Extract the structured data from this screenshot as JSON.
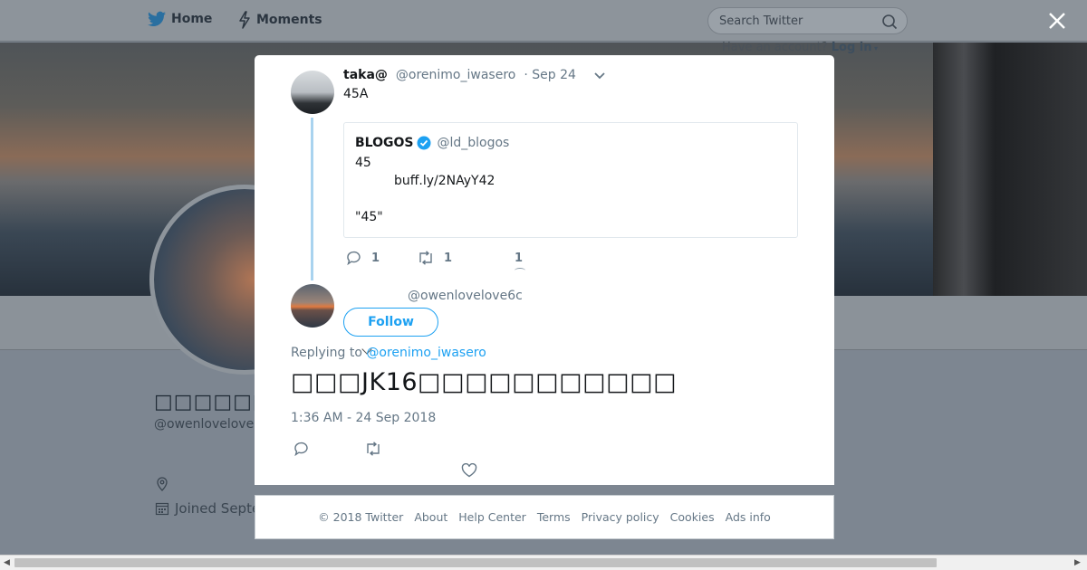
{
  "topbar": {
    "home_label": "Home",
    "moments_label": "Moments",
    "search_placeholder": "Search Twitter",
    "have_account": "Have an account?",
    "login_label": "Log in"
  },
  "profile": {
    "name": "□□□□□□□□□",
    "handle": "@owenlovelove",
    "joined": "Joined Septe"
  },
  "tweet": {
    "name": "taka@",
    "handle": "@orenimo_iwasero",
    "date": "· Sep 24",
    "text": "45A",
    "quote": {
      "name": "BLOGOS",
      "handle": "@ld_blogos",
      "line1": "45",
      "line2": "buff.ly/2NAyY42",
      "line3": "\"45\""
    },
    "reply_count": "1",
    "retweet_count": "1",
    "like_count": "1"
  },
  "reply": {
    "handle": "@owenlovelove6c",
    "follow_label": "Follow",
    "replying_to_label": "Replying to",
    "replying_to_handle": "@orenimo_iwasero",
    "text": "□□□JK16□□□□□□□□□□□",
    "timestamp": "1:36 AM - 24 Sep 2018"
  },
  "footer": {
    "links": [
      "© 2018 Twitter",
      "About",
      "Help Center",
      "Terms",
      "Privacy policy",
      "Cookies",
      "Ads info"
    ]
  },
  "colors": {
    "accent": "#1da1f2",
    "thread_line": "#a9d3ef",
    "muted_text": "#657786"
  }
}
